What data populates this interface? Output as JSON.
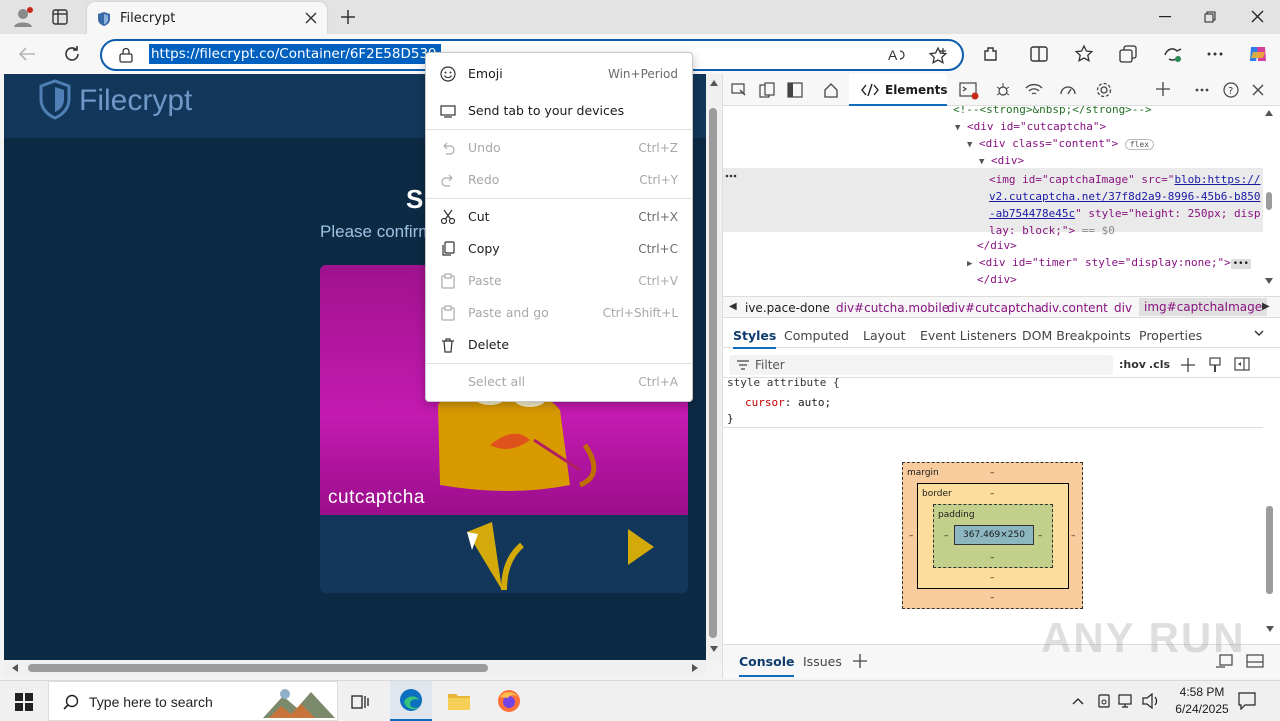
{
  "browser": {
    "tab_title": "Filecrypt",
    "url": "https://filecrypt.co/Container/6F2E58D539.html",
    "icons": [
      "profile-icon",
      "tab-actions-icon",
      "shield-icon",
      "close-icon",
      "new-tab-icon",
      "back-icon",
      "refresh-icon",
      "lock-icon",
      "read-aloud-icon",
      "favorite-icon",
      "extensions-icon",
      "split-screen-icon",
      "favorites-icon",
      "collections-icon",
      "performance-icon",
      "more-icon",
      "copilot-icon",
      "minimize-icon",
      "maximize-icon",
      "window-close-icon"
    ]
  },
  "page": {
    "logo_text": "Filecrypt",
    "heading_fragment": "S",
    "subheading_fragment": "Please confirm",
    "captcha_brand": "cutcaptcha"
  },
  "context_menu": {
    "items": [
      {
        "label": "Emoji",
        "shortcut": "Win+Period",
        "icon": "emoji-icon",
        "disabled": false
      },
      {
        "label": "Send tab to your devices",
        "shortcut": "",
        "icon": "send-tab-icon",
        "disabled": false
      },
      {
        "label": "Undo",
        "shortcut": "Ctrl+Z",
        "icon": "undo-icon",
        "disabled": true
      },
      {
        "label": "Redo",
        "shortcut": "Ctrl+Y",
        "icon": "redo-icon",
        "disabled": true
      },
      {
        "label": "Cut",
        "shortcut": "Ctrl+X",
        "icon": "cut-icon",
        "disabled": false
      },
      {
        "label": "Copy",
        "shortcut": "Ctrl+C",
        "icon": "copy-icon",
        "disabled": false
      },
      {
        "label": "Paste",
        "shortcut": "Ctrl+V",
        "icon": "paste-icon",
        "disabled": true
      },
      {
        "label": "Paste and go",
        "shortcut": "Ctrl+Shift+L",
        "icon": "paste-go-icon",
        "disabled": true
      },
      {
        "label": "Delete",
        "shortcut": "",
        "icon": "delete-icon",
        "disabled": false
      },
      {
        "label": "Select all",
        "shortcut": "Ctrl+A",
        "icon": "",
        "disabled": true
      }
    ]
  },
  "devtools": {
    "active_tab": "Elements",
    "dom_lines": [
      "<!--<strong>&nbsp;</strong>-->",
      "<div id=\"cutcaptcha\">",
      "<div class=\"content\">",
      "flex",
      "<div>",
      "<img id=\"captchaImage\" src=\"",
      "blob:https://",
      "v2.cutcaptcha.net/37f8d2a9-8996-45b6-b850",
      "-ab754478e45c",
      "\" style=\"height: 250px; disp",
      "lay: block;\">",
      "== $0",
      "</div>",
      "<div id=\"timer\" style=\"display:none;\">",
      "</div>"
    ],
    "breadcrumbs": [
      "ive.pace-done",
      "div#cutcha.mobile",
      "div#cutcaptcha",
      "div.content",
      "div",
      "img#captchaImage"
    ],
    "style_tabs": [
      "Styles",
      "Computed",
      "Layout",
      "Event Listeners",
      "DOM Breakpoints",
      "Properties"
    ],
    "filter_placeholder": "Filter",
    "filter_tools": [
      ":hov",
      ".cls"
    ],
    "style_rule": {
      "selector": "style attribute {",
      "property": "cursor",
      "value": "auto;",
      "close": "}"
    },
    "box_model": {
      "margin": "margin",
      "border": "border",
      "padding": "padding",
      "content": "367.469×250",
      "dash": "–"
    },
    "drawer_tabs": [
      "Console",
      "Issues"
    ],
    "watermark": "ANY RUN"
  },
  "taskbar": {
    "search_placeholder": "Type here to search",
    "time": "4:58 PM",
    "date": "6/24/2025"
  }
}
